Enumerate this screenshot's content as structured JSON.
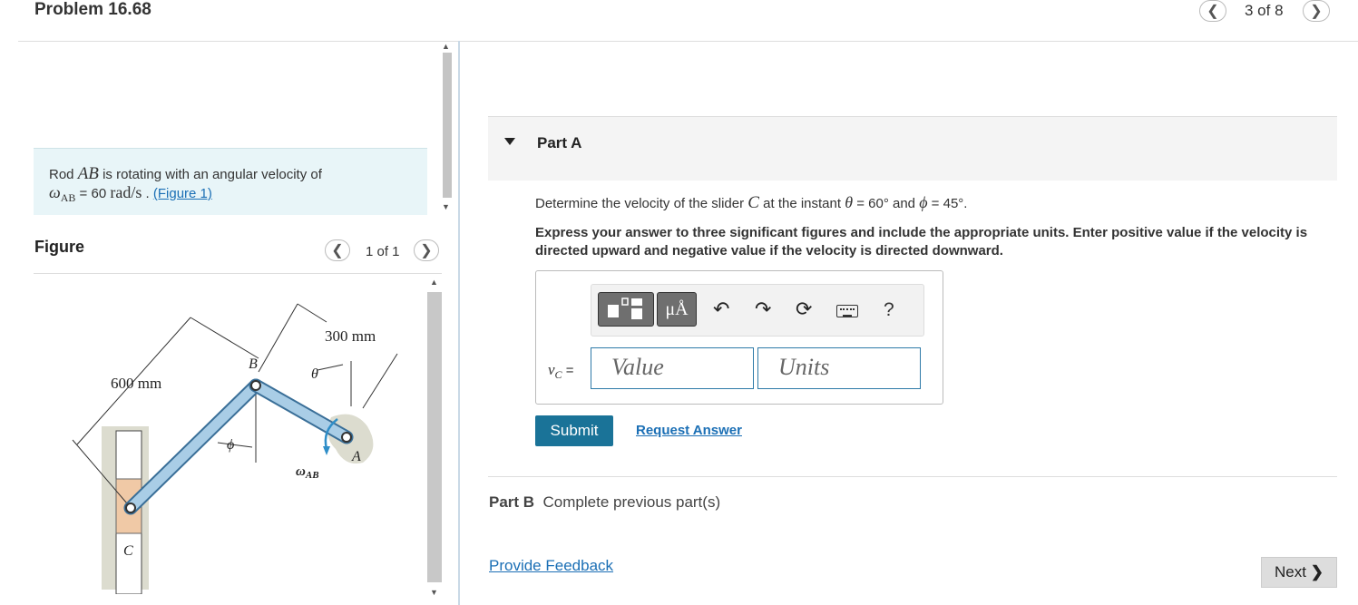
{
  "header": {
    "title": "Problem 16.68",
    "pager": "3 of 8",
    "prev_icon": "chevron-left-icon",
    "next_icon": "chevron-right-icon"
  },
  "intro": {
    "line1_prefix": "Rod ",
    "line1_var": "AB",
    "line1_suffix": " is rotating with an angular velocity of",
    "omega_symbol": "ω",
    "omega_sub": "AB",
    "equals_value": " = 60 ",
    "unit": "rad/s",
    "sep": " . ",
    "figure_link": "(Figure 1)"
  },
  "figure": {
    "header": "Figure",
    "pager": "1 of 1",
    "labels": {
      "dim_600": "600 mm",
      "dim_300": "300 mm",
      "point_B": "B",
      "point_A": "A",
      "point_C": "C",
      "theta": "θ",
      "phi": "ϕ",
      "omega": "ω",
      "omega_sub": "AB"
    }
  },
  "partA": {
    "label": "Part A",
    "question_prefix": "Determine the velocity of the slider ",
    "question_var": "C",
    "question_mid": " at the instant ",
    "theta": "θ",
    "theta_val": " = 60° and ",
    "phi": "ϕ",
    "phi_val": " = 45°.",
    "instructions": "Express your answer to three significant figures and include the appropriate units. Enter positive value if the velocity is directed upward and negative value if the velocity is directed downward.",
    "toolbar": {
      "templates_icon": "templates-icon",
      "units_button": "μÅ",
      "undo_icon": "undo-icon",
      "redo_icon": "redo-icon",
      "reset_icon": "reset-icon",
      "keyboard_icon": "keyboard-icon",
      "help": "?"
    },
    "var_label": "v",
    "var_sub": "C",
    "var_eq": " =",
    "value_placeholder": "Value",
    "units_placeholder": "Units",
    "submit": "Submit",
    "request": "Request Answer"
  },
  "partB": {
    "label": "Part B",
    "status": "Complete previous part(s)"
  },
  "footer": {
    "feedback": "Provide Feedback",
    "next": "Next"
  }
}
